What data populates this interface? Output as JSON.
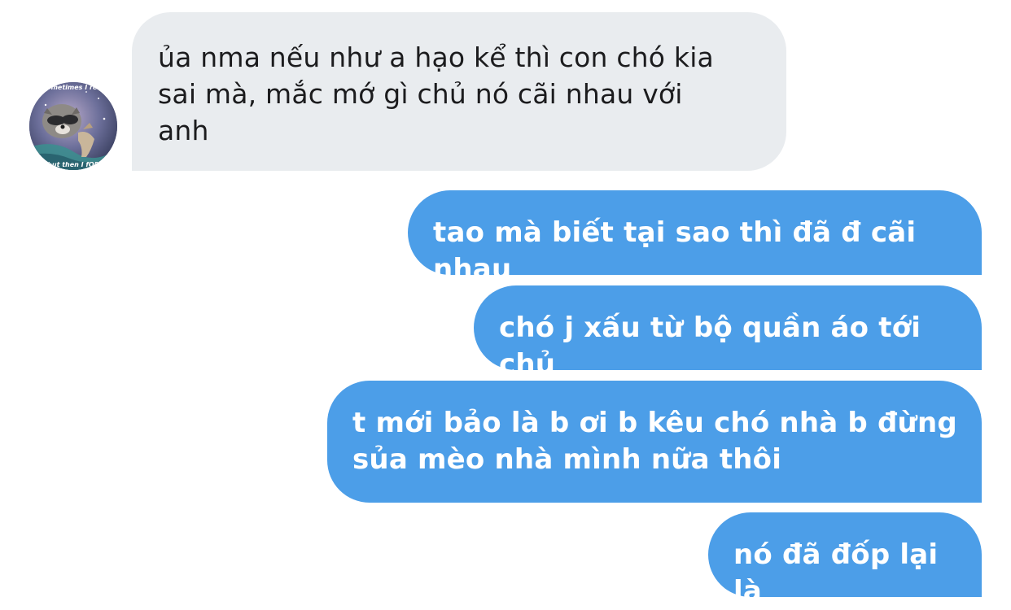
{
  "conversation": {
    "contact": {
      "avatar_icon": "raccoon-meme-avatar-icon",
      "avatar_caption_top": "sometimes I rem",
      "avatar_caption_bottom": "but then I fOR"
    },
    "messages": [
      {
        "direction": "incoming",
        "text": "ủa nma nếu như a hạo kể thì con chó kia\nsai mà, mắc mớ gì chủ nó cãi nhau với\nanh"
      },
      {
        "direction": "outgoing",
        "text": "tao mà biết tại sao thì đã đ cãi nhau"
      },
      {
        "direction": "outgoing",
        "text": "chó j xấu từ bộ quần áo tới chủ"
      },
      {
        "direction": "outgoing",
        "text": "t mới bảo là b ơi b kêu chó nhà b đừng\nsủa mèo nhà mình nữa thôi"
      },
      {
        "direction": "outgoing",
        "text": "nó đã đốp lại là"
      }
    ]
  },
  "colors": {
    "incoming_bubble": "#e9ecef",
    "outgoing_bubble": "#4c9ee8",
    "incoming_text": "#1c1c1e",
    "outgoing_text": "#ffffff",
    "background": "#ffffff"
  }
}
